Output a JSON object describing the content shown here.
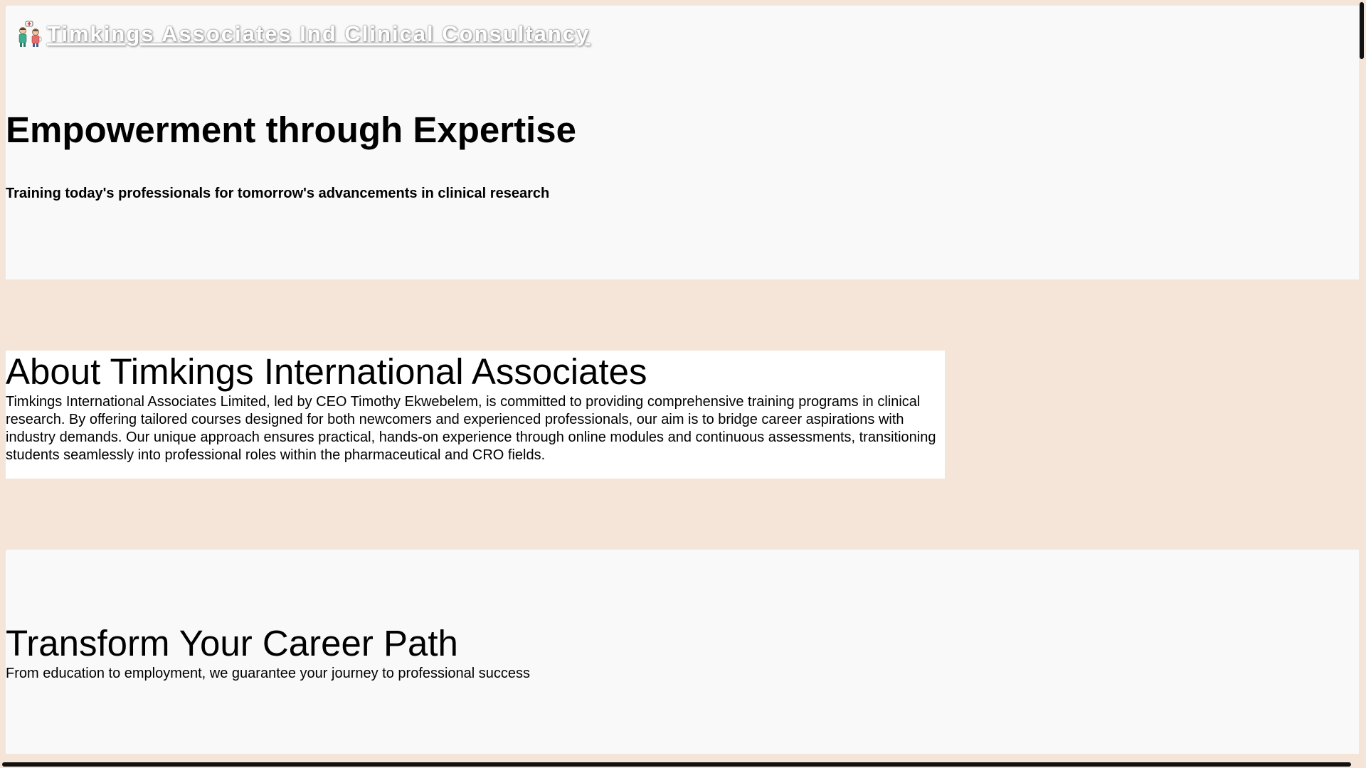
{
  "header": {
    "brand_name": "Timkings Associates Ind Clinical Consultancy",
    "logo_icon": "doctor-nurse-logo-icon"
  },
  "hero": {
    "title": "Empowerment through Expertise",
    "tagline": "Training today's professionals for tomorrow's advancements in clinical research"
  },
  "about": {
    "title": "About Timkings International Associates",
    "text": "Timkings International Associates Limited, led by CEO Timothy Ekwebelem, is committed to providing comprehensive training programs in clinical research. By offering tailored courses designed for both newcomers and experienced professionals, our aim is to bridge career aspirations with industry demands. Our unique approach ensures practical, hands-on experience through online modules and continuous assessments, transitioning students seamlessly into professional roles within the pharmaceutical and CRO fields."
  },
  "career": {
    "title": "Transform Your Career Path",
    "text": "From education to employment, we guarantee your journey to professional success"
  },
  "colors": {
    "page_background": "#f5e5d9",
    "section_background": "#f9f9f9",
    "about_background": "#ffffff",
    "scrollbar": "#111111"
  }
}
